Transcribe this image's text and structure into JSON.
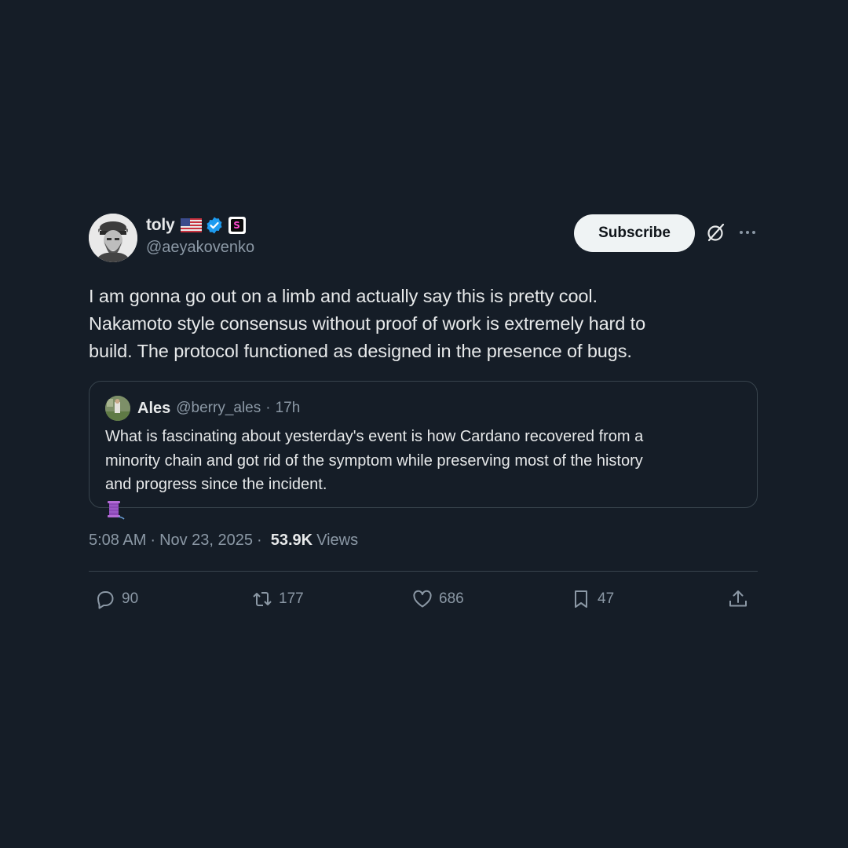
{
  "author": {
    "display_name": "toly",
    "handle": "@aeyakovenko",
    "badges": [
      "us-flag-icon",
      "verified-icon",
      "affiliate-badge-icon"
    ],
    "affiliate_letter": "S"
  },
  "header": {
    "subscribe_label": "Subscribe",
    "icons": [
      "grok-icon",
      "more-icon"
    ]
  },
  "tweet": {
    "text": "I am gonna go out on a limb and actually say this is pretty cool.\nNakamoto style consensus without proof of work is extremely hard to\nbuild.  The protocol functioned as designed in the presence of bugs."
  },
  "quote": {
    "display_name": "Ales",
    "handle": "@berry_ales",
    "separator": "·",
    "time": "17h",
    "text": "What is fascinating about yesterday's event is how Cardano recovered from a\nminority chain and got rid of the symptom while preserving most of the history\nand progress since the incident.",
    "trailing_icon": "thread-spool-icon"
  },
  "meta": {
    "time": "5:08 AM",
    "separator": "·",
    "date": "Nov 23, 2025",
    "views_count": "53.9K",
    "views_label": "Views"
  },
  "actions": {
    "replies": "90",
    "reposts": "177",
    "likes": "686",
    "bookmarks": "47"
  },
  "colors": {
    "background": "#151d27",
    "text_primary": "#e7e9ea",
    "text_secondary": "#8b98a5",
    "border": "#38444d",
    "verified": "#1d9bf0",
    "subscribe_bg": "#eff3f4"
  }
}
